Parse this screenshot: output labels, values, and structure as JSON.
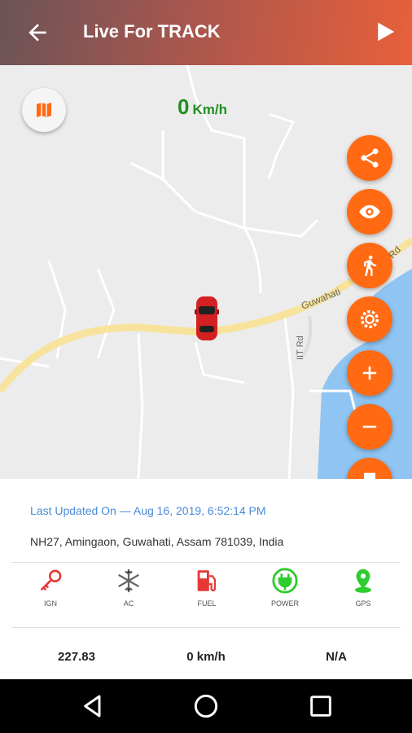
{
  "app_bar": {
    "title": "Live For TRACK"
  },
  "map": {
    "speed_value": "0",
    "speed_unit": "Km/h",
    "road_labels": [
      "Guwahati",
      "Rd",
      "IIT Rd"
    ],
    "fab_icons": [
      "share-icon",
      "eye-icon",
      "walk-icon",
      "settings-icon",
      "zoom-in-icon",
      "zoom-out-icon",
      "flag-icon"
    ]
  },
  "info": {
    "last_updated": "Last Updated On — Aug 16, 2019, 6:52:14 PM",
    "address": "NH27, Amingaon, Guwahati, Assam 781039, India"
  },
  "status_items": [
    {
      "label": "IGN",
      "color": "#e53935"
    },
    {
      "label": "AC",
      "color": "#666666"
    },
    {
      "label": "FUEL",
      "color": "#e53935"
    },
    {
      "label": "POWER",
      "color": "#2ecc2e"
    },
    {
      "label": "GPS",
      "color": "#2ecc2e"
    }
  ],
  "stats": {
    "distance": "227.83",
    "speed": "0 km/h",
    "extra": "N/A"
  },
  "colors": {
    "accent": "#ff6a13",
    "speed_green": "#1f8f1f",
    "link_blue": "#4a8ad8",
    "road": "#f7e39c",
    "water": "#8fc4f3"
  }
}
